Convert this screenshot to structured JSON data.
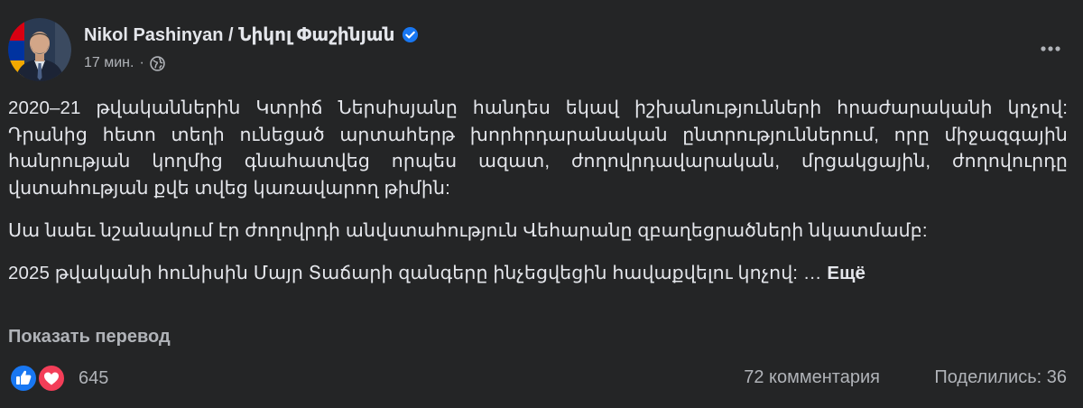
{
  "author": {
    "name": "Nikol Pashinyan / Նիկոլ Փաշինյան",
    "verified": true
  },
  "meta": {
    "time": "17 мин.",
    "separator": "·",
    "audience_icon": "globe-icon"
  },
  "post": {
    "paragraph_1": "2020–21 թվականներին Կտրիճ Ներսիսյանը հանդես եկավ իշխանությունների հրաժարականի կոչով: Դրանից հետո տեղի ունեցած արտահերթ խորհրդարանական ընտրություններում, որը միջազգային հանրության կողմից գնահատվեց որպես ազատ, ժողովրդավարական, մրցակցային, ժողովուրդը վստահության քվե տվեց կառավարող թիմին:",
    "paragraph_2": "Սա նաեւ նշանակում էր ժողովրդի անվստահություն Վեհարանը զբաղեցրածների նկատմամբ:",
    "paragraph_3": "2025 թվականի հունիսին Մայր Տաճարի զանգերը ինչեցվեցին հավաքվելու կոչով: …",
    "see_more": "Ещё"
  },
  "translate_label": "Показать перевод",
  "reactions": {
    "icons": [
      "like-icon",
      "love-icon"
    ],
    "count": "645"
  },
  "comments_label": "72 комментария",
  "shares_label": "Поделились: 36",
  "colors": {
    "background": "#242526",
    "primary_text": "#e4e6eb",
    "secondary_text": "#b0b3b8",
    "like_blue": "#1877f2",
    "love_red": "#f33e58"
  }
}
